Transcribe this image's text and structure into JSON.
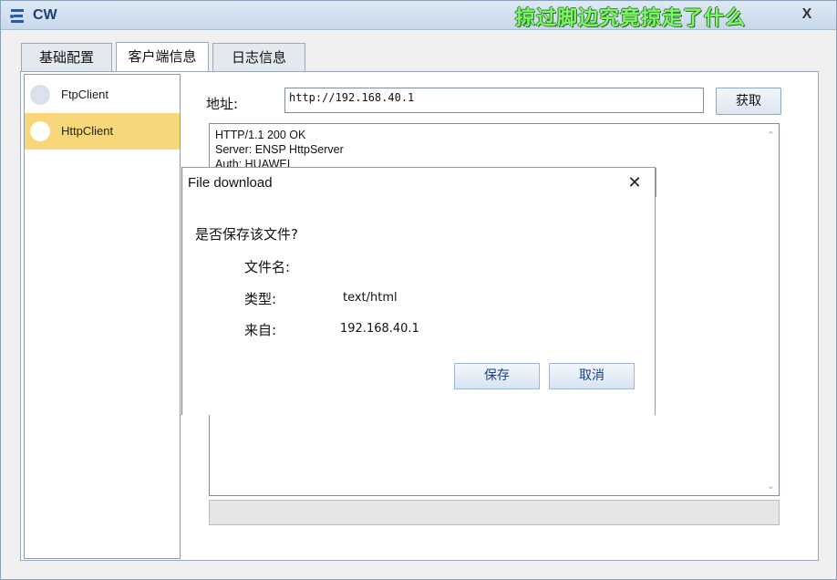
{
  "window": {
    "title": "CW",
    "banner_text": "掠过脚边究竟掠走了什么",
    "close_label": "X"
  },
  "tabs": [
    {
      "label": "基础配置"
    },
    {
      "label": "客户端信息"
    },
    {
      "label": "日志信息"
    }
  ],
  "sidebar": {
    "items": [
      {
        "label": "FtpClient",
        "selected": false
      },
      {
        "label": "HttpClient",
        "selected": true
      }
    ]
  },
  "form": {
    "address_label": "地址:",
    "address_value": "http://192.168.40.1",
    "fetch_label": "获取"
  },
  "response": {
    "lines": "HTTP/1.1 200 OK\nServer: ENSP HttpServer\nAuth: HUAWEI"
  },
  "dialog": {
    "title": "File download",
    "close_glyph": "✕",
    "question": "是否保存该文件?",
    "filename_label": "文件名:",
    "filename_value": "",
    "type_label": "类型:",
    "type_value": "text/html",
    "from_label": "来自:",
    "from_value": "192.168.40.1",
    "save_label": "保存",
    "cancel_label": "取消"
  },
  "icons": {
    "app": "network-tool-icon",
    "scroll_up": "chevron-up-icon",
    "scroll_down": "chevron-down-icon"
  },
  "colors": {
    "selected_row": "#f8d77a",
    "banner": "#7cf76a",
    "titlebar": "#c8d8ea"
  }
}
